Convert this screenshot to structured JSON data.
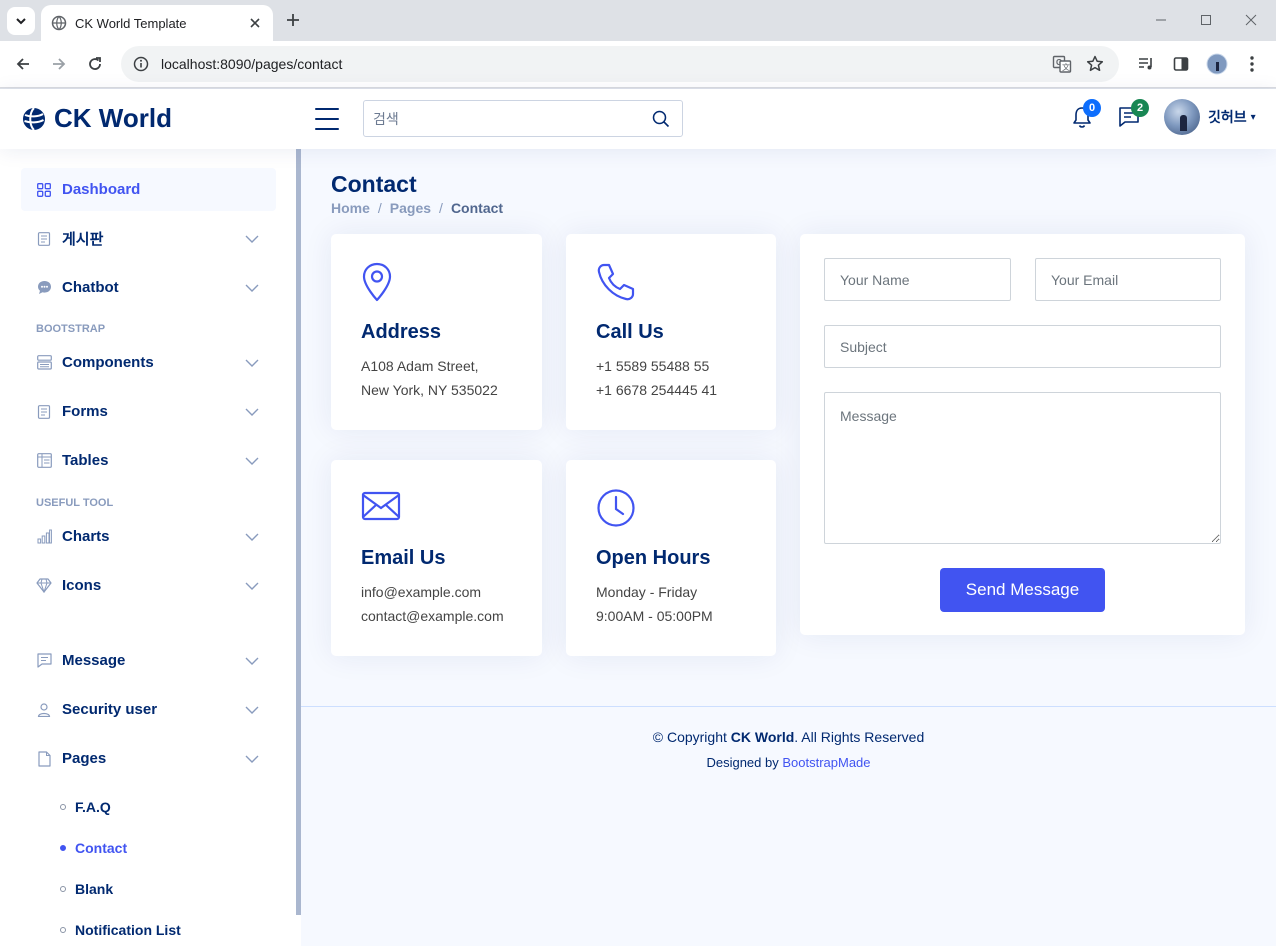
{
  "browser": {
    "tab_title": "CK World Template",
    "url": "localhost:8090/pages/contact"
  },
  "header": {
    "logo_text": "CK World",
    "search_placeholder": "검색",
    "notifications_count": "0",
    "messages_count": "2",
    "profile_name": "깃허브",
    "colors": {
      "accent": "#4154f1",
      "notif_badge": "#0d6efd",
      "msg_badge": "#198754"
    }
  },
  "sidebar": {
    "items": [
      {
        "label": "Dashboard",
        "icon": "grid-icon"
      },
      {
        "label": "게시판",
        "icon": "journal-icon"
      },
      {
        "label": "Chatbot",
        "icon": "chat-dots-icon"
      },
      {
        "label": "Components",
        "icon": "menu-button-icon"
      },
      {
        "label": "Forms",
        "icon": "journal-text-icon"
      },
      {
        "label": "Tables",
        "icon": "layout-text-icon"
      },
      {
        "label": "Charts",
        "icon": "bar-chart-icon"
      },
      {
        "label": "Icons",
        "icon": "gem-icon"
      },
      {
        "label": "Message",
        "icon": "chat-left-text-icon"
      },
      {
        "label": "Security user",
        "icon": "person-icon"
      },
      {
        "label": "Pages",
        "icon": "file-icon"
      }
    ],
    "headings": [
      "BOOTSTRAP",
      "USEFUL TOOL"
    ],
    "sub_items": [
      "F.A.Q",
      "Contact",
      "Blank",
      "Notification List"
    ]
  },
  "main": {
    "title": "Contact",
    "breadcrumb": [
      "Home",
      "Pages",
      "Contact"
    ],
    "cards": [
      {
        "title": "Address",
        "line1": "A108 Adam Street,",
        "line2": "New York, NY 535022",
        "icon": "geo-pin-icon"
      },
      {
        "title": "Call Us",
        "line1": "+1 5589 55488 55",
        "line2": "+1 6678 254445 41",
        "icon": "telephone-icon"
      },
      {
        "title": "Email Us",
        "line1": "info@example.com",
        "line2": "contact@example.com",
        "icon": "envelope-icon"
      },
      {
        "title": "Open Hours",
        "line1": "Monday - Friday",
        "line2": "9:00AM - 05:00PM",
        "icon": "clock-icon"
      }
    ],
    "form": {
      "name_placeholder": "Your Name",
      "email_placeholder": "Your Email",
      "subject_placeholder": "Subject",
      "message_placeholder": "Message",
      "send_label": "Send Message"
    }
  },
  "footer": {
    "copyright_prefix": "© Copyright",
    "brand": "CK World",
    "copyright_suffix": ". All Rights Reserved",
    "designed_by": "Designed by",
    "designer": "BootstrapMade"
  }
}
